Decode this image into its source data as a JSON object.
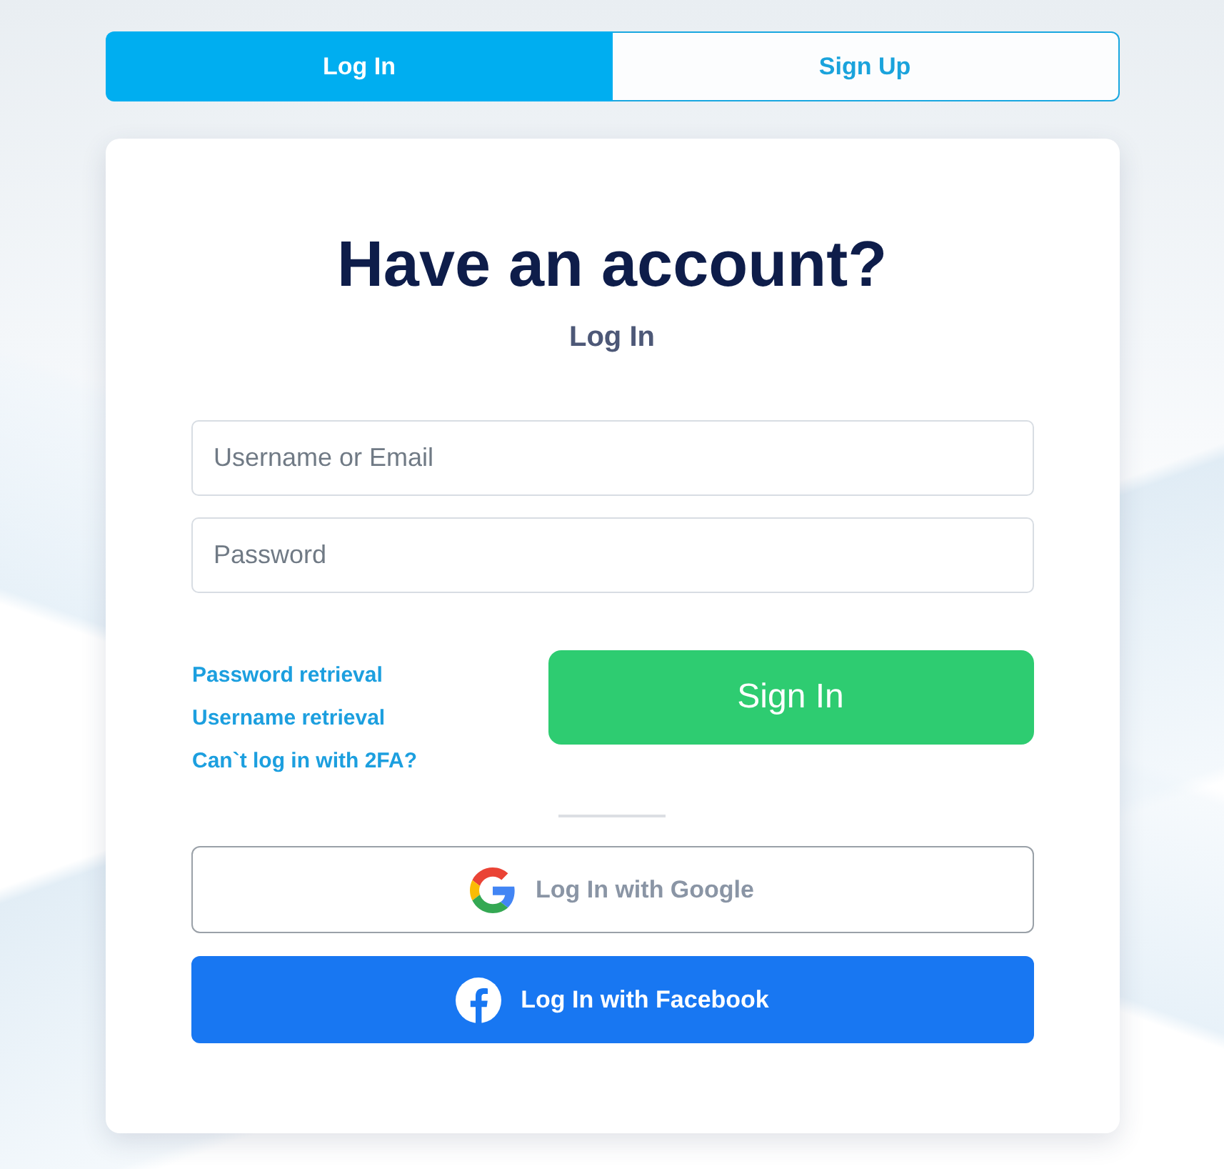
{
  "tabs": [
    {
      "label": "Log In",
      "selected": true
    },
    {
      "label": "Sign Up",
      "selected": false
    }
  ],
  "card": {
    "title": "Have an account?",
    "subtitle": "Log In",
    "fields": [
      {
        "placeholder": "Username or Email"
      },
      {
        "placeholder": "Password"
      }
    ],
    "links": [
      "Password retrieval",
      "Username retrieval",
      "Can`t log in with 2FA?"
    ],
    "submit": "Sign In",
    "social": [
      {
        "kind": "google",
        "label": "Log In with Google"
      },
      {
        "kind": "facebook",
        "label": "Log In with Facebook"
      }
    ]
  }
}
